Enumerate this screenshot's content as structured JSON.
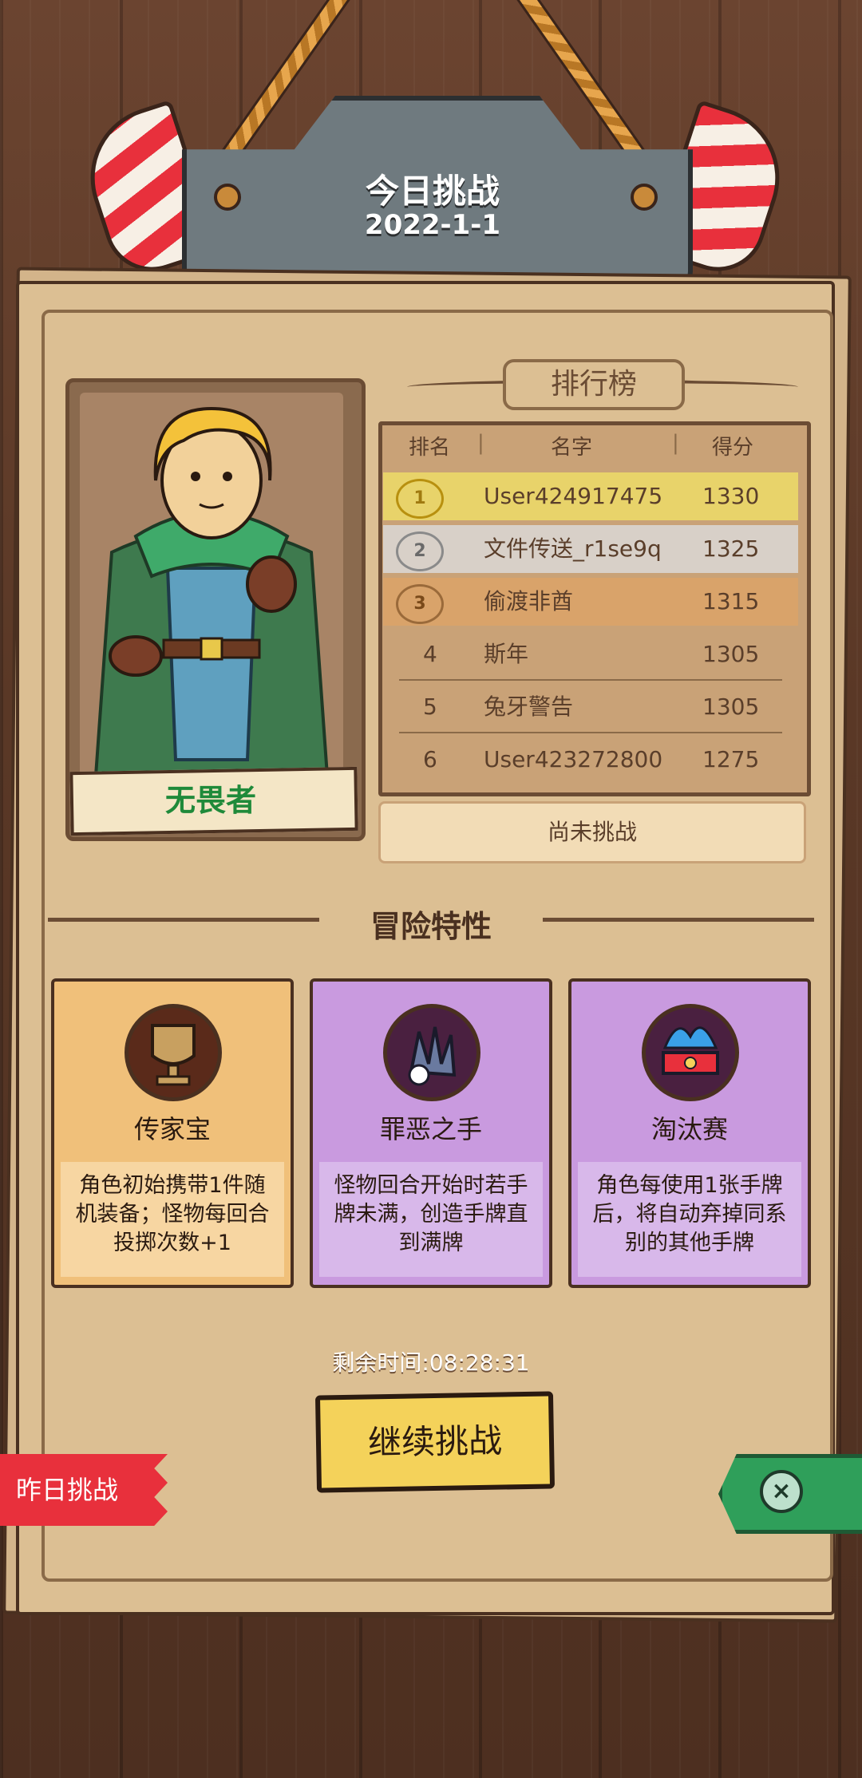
{
  "header": {
    "title": "今日挑战",
    "date": "2022-1-1"
  },
  "hero": {
    "name": "无畏者"
  },
  "leaderboard": {
    "title": "排行榜",
    "columns": [
      "排名",
      "名字",
      "得分"
    ],
    "rows": [
      {
        "rank": "1",
        "name": "User424917475",
        "score": "1330"
      },
      {
        "rank": "2",
        "name": "文件传送_r1se9q",
        "score": "1325"
      },
      {
        "rank": "3",
        "name": "偷渡非酋",
        "score": "1315"
      },
      {
        "rank": "4",
        "name": "斯年",
        "score": "1305"
      },
      {
        "rank": "5",
        "name": "兔牙警告",
        "score": "1305"
      },
      {
        "rank": "6",
        "name": "User423272800",
        "score": "1275"
      }
    ],
    "status": "尚未挑战"
  },
  "traits": {
    "title": "冒险特性",
    "items": [
      {
        "name": "传家宝",
        "desc": "角色初始携带1件随机装备；怪物每回合投掷次数+1",
        "icon": "goblet-icon",
        "color": "#f0c07a"
      },
      {
        "name": "罪恶之手",
        "desc": "怪物回合开始时若手牌未满，创造手牌直到满牌",
        "icon": "claw-icon",
        "color": "#c99adf"
      },
      {
        "name": "淘汰赛",
        "desc": "角色每使用1张手牌后，将自动弃掉同系别的其他手牌",
        "icon": "flaming-crown-icon",
        "color": "#c99adf"
      }
    ]
  },
  "timer": "剩余时间:08:28:31",
  "buttons": {
    "continue": "继续挑战",
    "yesterday": "昨日挑战"
  },
  "colors": {
    "rank1": "#e8d36a",
    "rank2": "#d8d0c8",
    "rank3": "#d9a36a",
    "accent_red": "#e8303c",
    "accent_green": "#2f9f5a"
  }
}
